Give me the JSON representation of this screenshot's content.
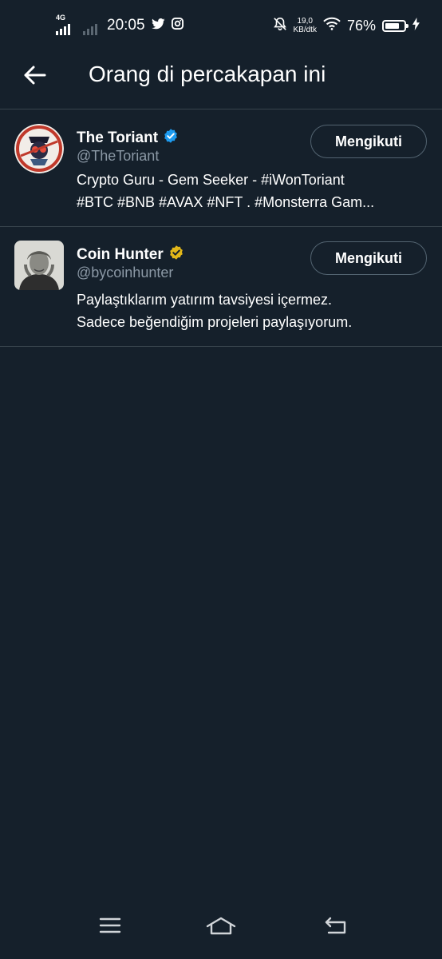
{
  "status_bar": {
    "network": "4G",
    "time": "20:05",
    "speed_value": "19,0",
    "speed_unit": "KB/dtk",
    "battery_percent": "76%",
    "battery_level": 0.76,
    "icons": [
      "twitter-icon",
      "instagram-icon",
      "mute-notification-icon",
      "wifi-icon",
      "battery-icon",
      "charging-icon"
    ]
  },
  "header": {
    "back_icon": "arrow-left-icon",
    "title": "Orang di percakapan ini"
  },
  "users": [
    {
      "name": "The Toriant",
      "verified_color": "#1d9bf0",
      "handle": "@TheToriant",
      "follow_label": "Mengikuti",
      "bio_lines": [
        "Crypto Guru - Gem Seeker - #iWonToriant",
        "#BTC #BNB #AVAX #NFT . #Monsterra Gam..."
      ]
    },
    {
      "name": "Coin Hunter",
      "verified_color": "#e2b719",
      "handle": "@bycoinhunter",
      "follow_label": "Mengikuti",
      "bio_lines": [
        "Paylaştıklarım yatırım tavsiyesi içermez.",
        "Sadece beğendiğim projeleri paylaşıyorum."
      ]
    }
  ],
  "nav_bar": {
    "icons": [
      "menu-icon",
      "home-icon",
      "back-nav-icon"
    ]
  },
  "colors": {
    "background": "#15202b",
    "divider": "#38444d",
    "secondary_text": "#8b98a5"
  }
}
